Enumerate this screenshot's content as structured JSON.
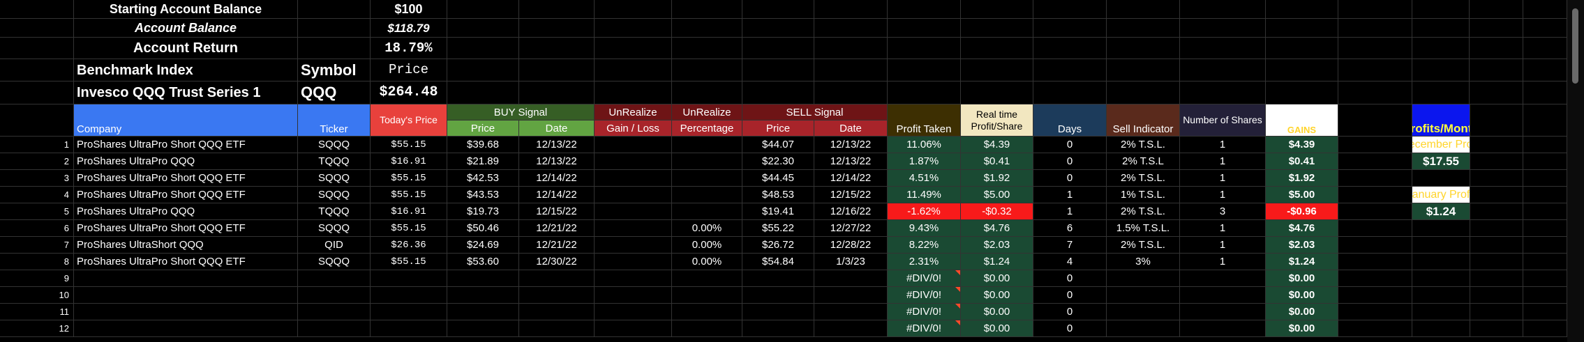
{
  "account": {
    "starting_label": "Starting Account Balance",
    "starting_value": "$100",
    "balance_label": "Account Balance",
    "balance_value": "$118.79",
    "return_label": "Account Return",
    "return_value": "18.79%"
  },
  "benchmark": {
    "index_label": "Benchmark Index",
    "symbol_label": "Symbol",
    "price_label": "Price",
    "index_name": "Invesco QQQ Trust Series 1",
    "symbol": "QQQ",
    "price": "$264.48"
  },
  "headers": {
    "company": "Company",
    "ticker": "Ticker",
    "todays_price": "Today's Price",
    "buy_signal": "BUY Signal",
    "buy_price": "Price",
    "buy_date": "Date",
    "unrealize1": "UnRealize",
    "gain_loss": "Gain / Loss",
    "unrealize2": "UnRealize",
    "percentage": "Percentage",
    "sell_signal": "SELL Signal",
    "sell_price": "Price",
    "sell_date": "Date",
    "profit_taken": "Profit Taken",
    "realtime": "Real time Profit/Share",
    "days": "Days",
    "sell_indicator": "Sell Indicator",
    "num_shares": "Number of Shares",
    "gains": "GAINS"
  },
  "rows": [
    {
      "n": "1",
      "company": "ProShares UltraPro Short QQQ ETF",
      "ticker": "SQQQ",
      "today": "$55.15",
      "buy_price": "$39.68",
      "buy_date": "12/13/22",
      "pct": "",
      "sell_price": "$44.07",
      "sell_date": "12/13/22",
      "profit": "11.06%",
      "rt": "$4.39",
      "days": "0",
      "ind": "2% T.S.L.",
      "shares": "1",
      "gains": "$4.39",
      "neg": false
    },
    {
      "n": "2",
      "company": "ProShares UltraPro QQQ",
      "ticker": "TQQQ",
      "today": "$16.91",
      "buy_price": "$21.89",
      "buy_date": "12/13/22",
      "pct": "",
      "sell_price": "$22.30",
      "sell_date": "12/13/22",
      "profit": "1.87%",
      "rt": "$0.41",
      "days": "0",
      "ind": "2% T.S.L",
      "shares": "1",
      "gains": "$0.41",
      "neg": false
    },
    {
      "n": "3",
      "company": "ProShares UltraPro Short QQQ ETF",
      "ticker": "SQQQ",
      "today": "$55.15",
      "buy_price": "$42.53",
      "buy_date": "12/14/22",
      "pct": "",
      "sell_price": "$44.45",
      "sell_date": "12/14/22",
      "profit": "4.51%",
      "rt": "$1.92",
      "days": "0",
      "ind": "2% T.S.L.",
      "shares": "1",
      "gains": "$1.92",
      "neg": false
    },
    {
      "n": "4",
      "company": "ProShares UltraPro Short QQQ ETF",
      "ticker": "SQQQ",
      "today": "$55.15",
      "buy_price": "$43.53",
      "buy_date": "12/14/22",
      "pct": "",
      "sell_price": "$48.53",
      "sell_date": "12/15/22",
      "profit": "11.49%",
      "rt": "$5.00",
      "days": "1",
      "ind": "1% T.S.L.",
      "shares": "1",
      "gains": "$5.00",
      "neg": false
    },
    {
      "n": "5",
      "company": "ProShares UltraPro QQQ",
      "ticker": "TQQQ",
      "today": "$16.91",
      "buy_price": "$19.73",
      "buy_date": "12/15/22",
      "pct": "",
      "sell_price": "$19.41",
      "sell_date": "12/16/22",
      "profit": "-1.62%",
      "rt": "-$0.32",
      "days": "1",
      "ind": "2% T.S.L.",
      "shares": "3",
      "gains": "-$0.96",
      "neg": true
    },
    {
      "n": "6",
      "company": "ProShares UltraPro Short QQQ ETF",
      "ticker": "SQQQ",
      "today": "$55.15",
      "buy_price": "$50.46",
      "buy_date": "12/21/22",
      "pct": "0.00%",
      "sell_price": "$55.22",
      "sell_date": "12/27/22",
      "profit": "9.43%",
      "rt": "$4.76",
      "days": "6",
      "ind": "1.5% T.S.L.",
      "shares": "1",
      "gains": "$4.76",
      "neg": false
    },
    {
      "n": "7",
      "company": "ProShares UltraShort QQQ",
      "ticker": "QID",
      "today": "$26.36",
      "buy_price": "$24.69",
      "buy_date": "12/21/22",
      "pct": "0.00%",
      "sell_price": "$26.72",
      "sell_date": "12/28/22",
      "profit": "8.22%",
      "rt": "$2.03",
      "days": "7",
      "ind": "2% T.S.L.",
      "shares": "1",
      "gains": "$2.03",
      "neg": false
    },
    {
      "n": "8",
      "company": "ProShares UltraPro Short QQQ ETF",
      "ticker": "SQQQ",
      "today": "$55.15",
      "buy_price": "$53.60",
      "buy_date": "12/30/22",
      "pct": "0.00%",
      "sell_price": "$54.84",
      "sell_date": "1/3/23",
      "profit": "2.31%",
      "rt": "$1.24",
      "days": "4",
      "ind": "3%",
      "shares": "1",
      "gains": "$1.24",
      "neg": false
    },
    {
      "n": "9",
      "company": "",
      "ticker": "",
      "today": "",
      "buy_price": "",
      "buy_date": "",
      "pct": "",
      "sell_price": "",
      "sell_date": "",
      "profit": "#DIV/0!",
      "rt": "$0.00",
      "days": "0",
      "ind": "",
      "shares": "",
      "gains": "$0.00",
      "neg": false
    },
    {
      "n": "10",
      "company": "",
      "ticker": "",
      "today": "",
      "buy_price": "",
      "buy_date": "",
      "pct": "",
      "sell_price": "",
      "sell_date": "",
      "profit": "#DIV/0!",
      "rt": "$0.00",
      "days": "0",
      "ind": "",
      "shares": "",
      "gains": "$0.00",
      "neg": false
    },
    {
      "n": "11",
      "company": "",
      "ticker": "",
      "today": "",
      "buy_price": "",
      "buy_date": "",
      "pct": "",
      "sell_price": "",
      "sell_date": "",
      "profit": "#DIV/0!",
      "rt": "$0.00",
      "days": "0",
      "ind": "",
      "shares": "",
      "gains": "$0.00",
      "neg": false
    },
    {
      "n": "12",
      "company": "",
      "ticker": "",
      "today": "",
      "buy_price": "",
      "buy_date": "",
      "pct": "",
      "sell_price": "",
      "sell_date": "",
      "profit": "#DIV/0!",
      "rt": "$0.00",
      "days": "0",
      "ind": "",
      "shares": "",
      "gains": "$0.00",
      "neg": false
    }
  ],
  "profits_month": {
    "title": "Profits/Month",
    "december_label": "December Profit",
    "december_value": "$17.55",
    "january_label": "January Profit",
    "january_value": "$1.24"
  },
  "colors": {
    "blue_header": "#3a78f2",
    "red_header": "#e8413c",
    "buy_dark": "#365e25",
    "buy_light": "#62a442",
    "unreal_dark": "#6e1416",
    "unreal_light": "#a8242a",
    "profit_header": "#3d2f02",
    "profit_cells": "#1a4a33",
    "realtime_header": "#f2e7c0",
    "days_header": "#1c3b5b",
    "indicator_header": "#5a2a1c",
    "shares_header": "#232038",
    "gains_header_text": "#ffd42a",
    "negative": "#f81a1a",
    "profits_month_bg": "#0b16ee",
    "profits_month_text": "#ffff3a"
  }
}
